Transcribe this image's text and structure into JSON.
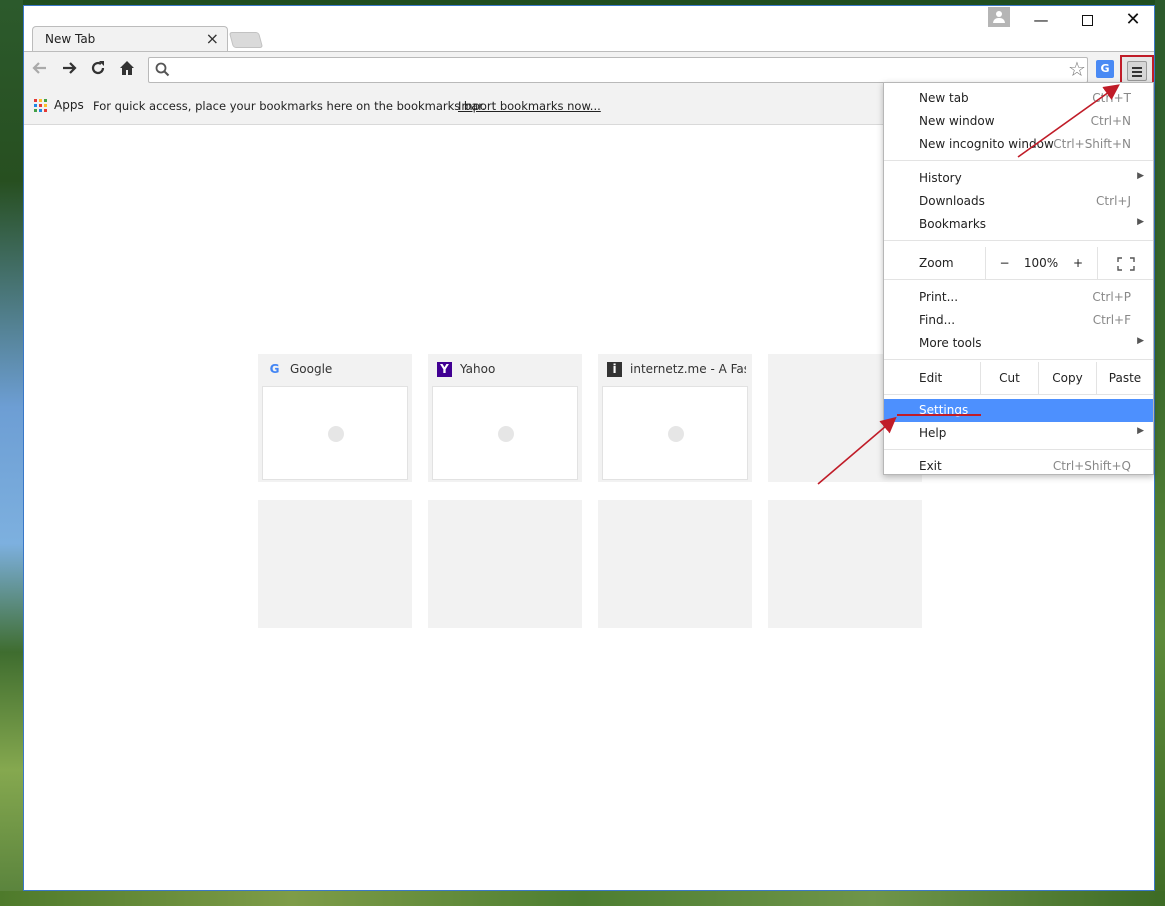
{
  "tab": {
    "title": "New Tab",
    "close": "×"
  },
  "window_controls": {
    "minimize": "—",
    "close": "✕"
  },
  "bookmarks_bar": {
    "apps_label": "Apps",
    "message": "For quick access, place your bookmarks here on the bookmarks bar.",
    "import_link": "Import bookmarks now..."
  },
  "tiles": [
    {
      "title": "Google",
      "favicon": "G",
      "favicon_color": "#4285f4"
    },
    {
      "title": "Yahoo",
      "favicon": "Y",
      "favicon_color": "#410093"
    },
    {
      "title": "internetz.me - A Fast a",
      "favicon": "i",
      "favicon_color": "#333333"
    }
  ],
  "menu": {
    "new_tab": {
      "label": "New tab",
      "shortcut": "Ctrl+T"
    },
    "new_window": {
      "label": "New window",
      "shortcut": "Ctrl+N"
    },
    "new_incognito": {
      "label": "New incognito window",
      "shortcut": "Ctrl+Shift+N"
    },
    "history": {
      "label": "History"
    },
    "downloads": {
      "label": "Downloads",
      "shortcut": "Ctrl+J"
    },
    "bookmarks": {
      "label": "Bookmarks"
    },
    "zoom": {
      "label": "Zoom",
      "minus": "−",
      "value": "100%",
      "plus": "+"
    },
    "print": {
      "label": "Print...",
      "shortcut": "Ctrl+P"
    },
    "find": {
      "label": "Find...",
      "shortcut": "Ctrl+F"
    },
    "more_tools": {
      "label": "More tools"
    },
    "edit": {
      "label": "Edit",
      "cut": "Cut",
      "copy": "Copy",
      "paste": "Paste"
    },
    "settings": {
      "label": "Settings"
    },
    "help": {
      "label": "Help"
    },
    "exit": {
      "label": "Exit",
      "shortcut": "Ctrl+Shift+Q"
    }
  },
  "colors": {
    "accent": "#4d90fe",
    "annotation": "#c01c28",
    "window_border": "#3a78c8"
  },
  "icons": {
    "back": "back-arrow-icon",
    "forward": "forward-arrow-icon",
    "reload": "reload-icon",
    "home": "home-icon",
    "search": "search-icon",
    "star": "bookmark-star-icon",
    "translate": "translate-icon",
    "menu": "hamburger-menu-icon",
    "apps": "apps-grid-icon",
    "avatar": "user-avatar-icon"
  }
}
